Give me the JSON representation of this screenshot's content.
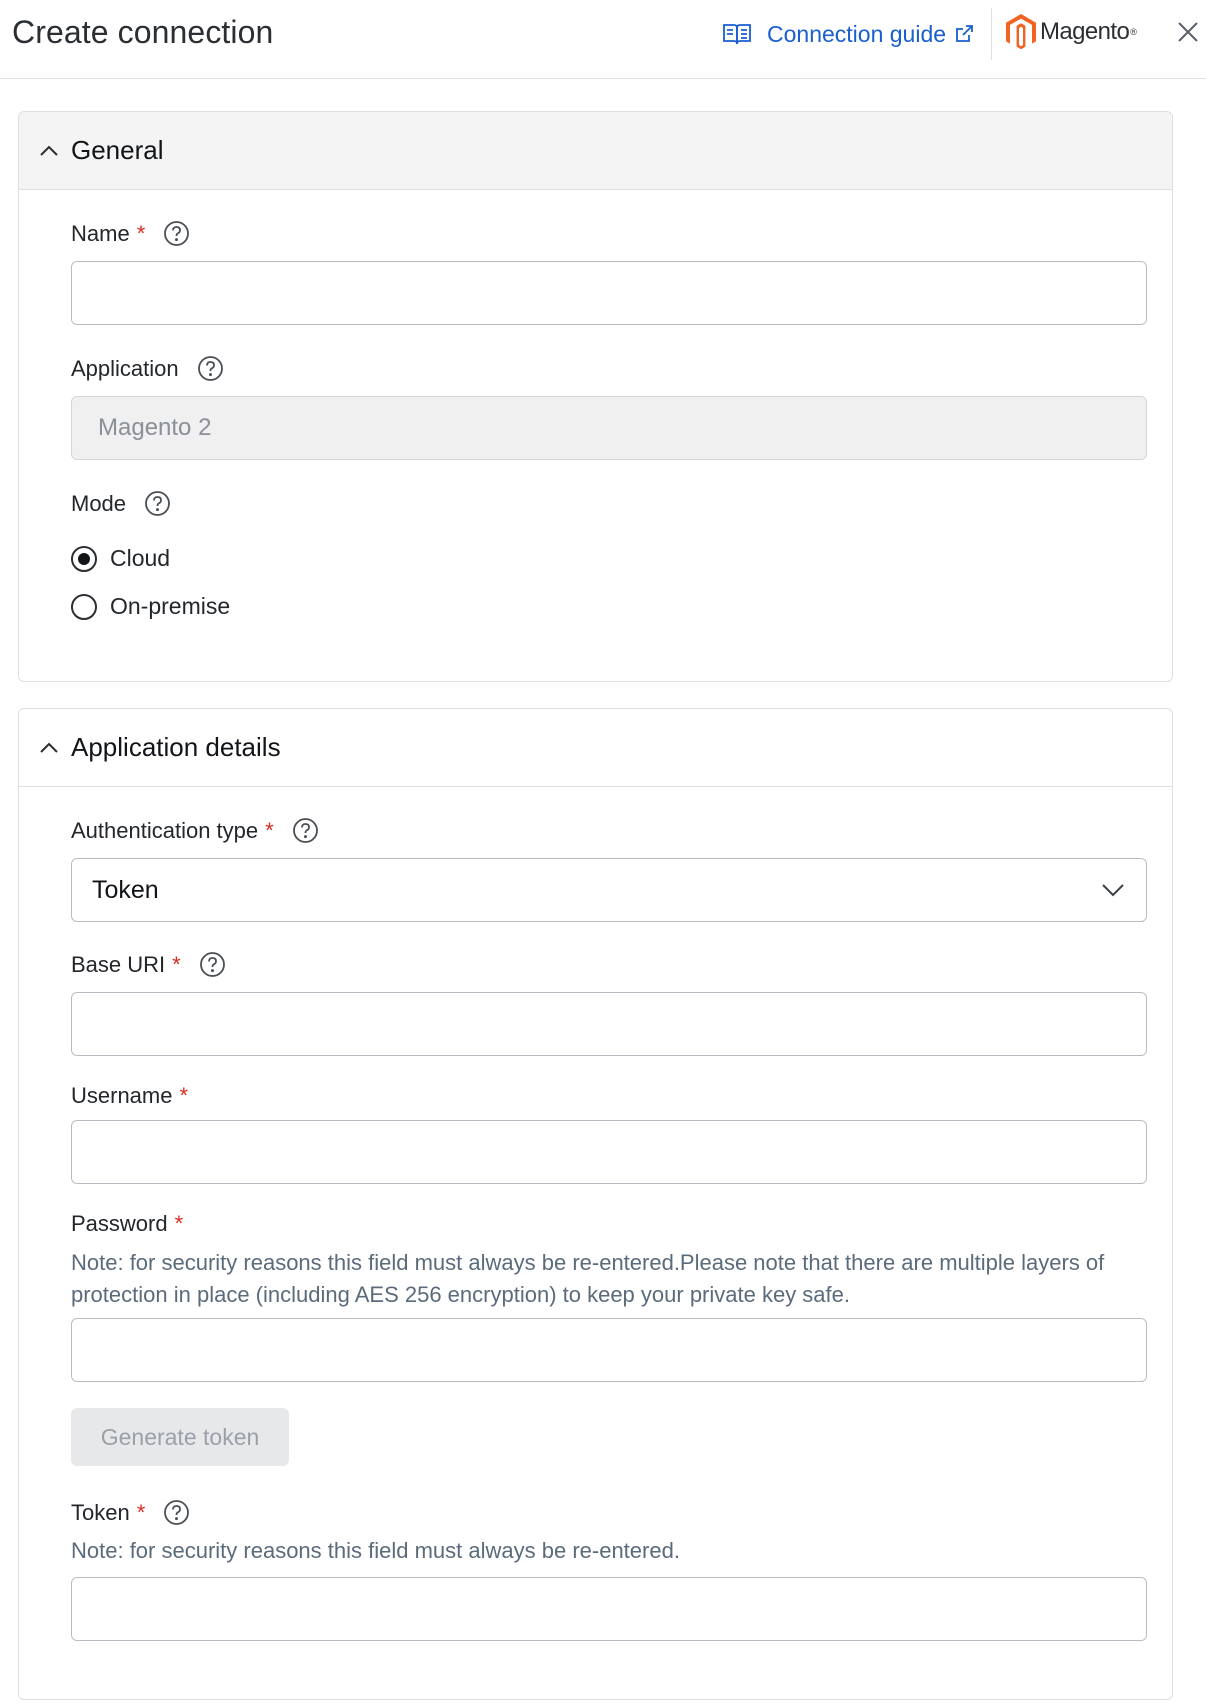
{
  "header": {
    "title": "Create connection",
    "guide_label": "Connection guide",
    "brand_name": "Magento",
    "brand_mark": "®"
  },
  "general": {
    "title": "General",
    "name_label": "Name",
    "name_value": "",
    "application_label": "Application",
    "application_value": "Magento 2",
    "mode_label": "Mode",
    "mode_options": [
      {
        "label": "Cloud",
        "checked": true
      },
      {
        "label": "On-premise",
        "checked": false
      }
    ]
  },
  "details": {
    "title": "Application details",
    "auth_label": "Authentication type",
    "auth_value": "Token",
    "base_uri_label": "Base URI",
    "base_uri_value": "",
    "username_label": "Username",
    "username_value": "",
    "password_label": "Password",
    "password_note": "Note: for security reasons this field must always be re-entered.Please note that there are multiple layers of protection in place (including AES 256 encryption) to keep your private key safe.",
    "password_value": "",
    "generate_label": "Generate token",
    "token_label": "Token",
    "token_note": "Note: for security reasons this field must always be re-entered.",
    "token_value": ""
  },
  "required_mark": "*",
  "colors": {
    "accent": "#1a5fd0",
    "required": "#d92d20",
    "brand_orange": "#f26322",
    "note_text": "#5b6b7c"
  },
  "icons": {
    "guide": "book-icon",
    "external": "external-link-icon",
    "close": "close-icon",
    "collapse": "chevron-up-icon",
    "help": "help-circle-icon",
    "dropdown": "chevron-down-icon"
  }
}
